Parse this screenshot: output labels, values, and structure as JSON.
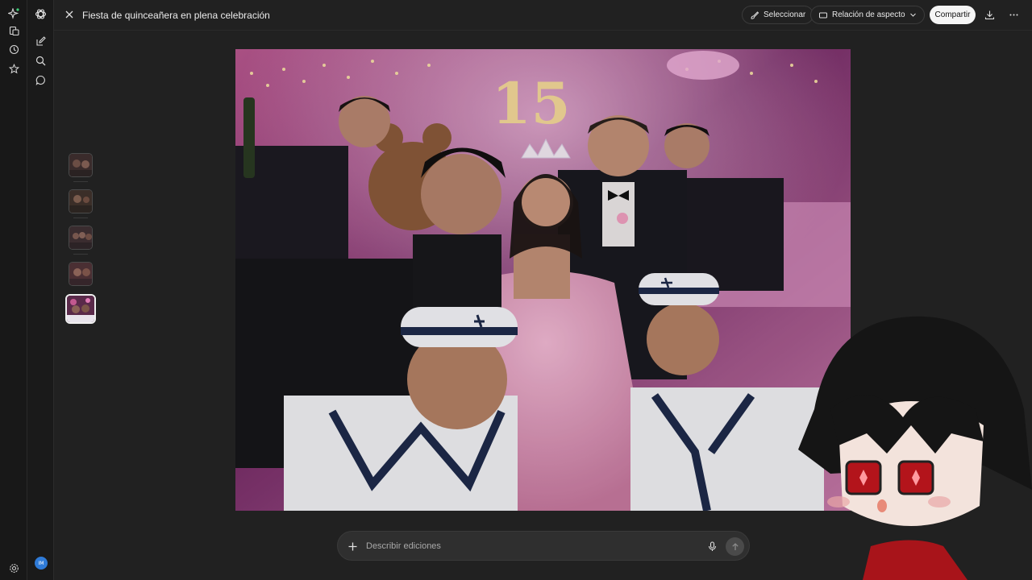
{
  "header": {
    "title": "Fiesta de quinceañera en plena celebración",
    "select_label": "Seleccionar",
    "aspect_label": "Relación de aspecto",
    "share_label": "Compartir"
  },
  "image": {
    "cake_number": "15"
  },
  "prompt": {
    "placeholder": "Describir ediciones"
  },
  "user": {
    "initials": "IM"
  },
  "icons": {
    "outer_rail": [
      "sparkle-icon",
      "library-icon",
      "history-icon",
      "star-icon",
      "settings-icon"
    ],
    "inner_rail": [
      "chatgpt-logo-icon",
      "new-chat-icon",
      "search-icon",
      "chat-bubble-icon"
    ]
  },
  "colors": {
    "background": "#212121",
    "rail": "#181818",
    "accent_green": "#3fd17a",
    "avatar_blue": "#2f7bd8",
    "share_bg": "#f5f5f5"
  }
}
